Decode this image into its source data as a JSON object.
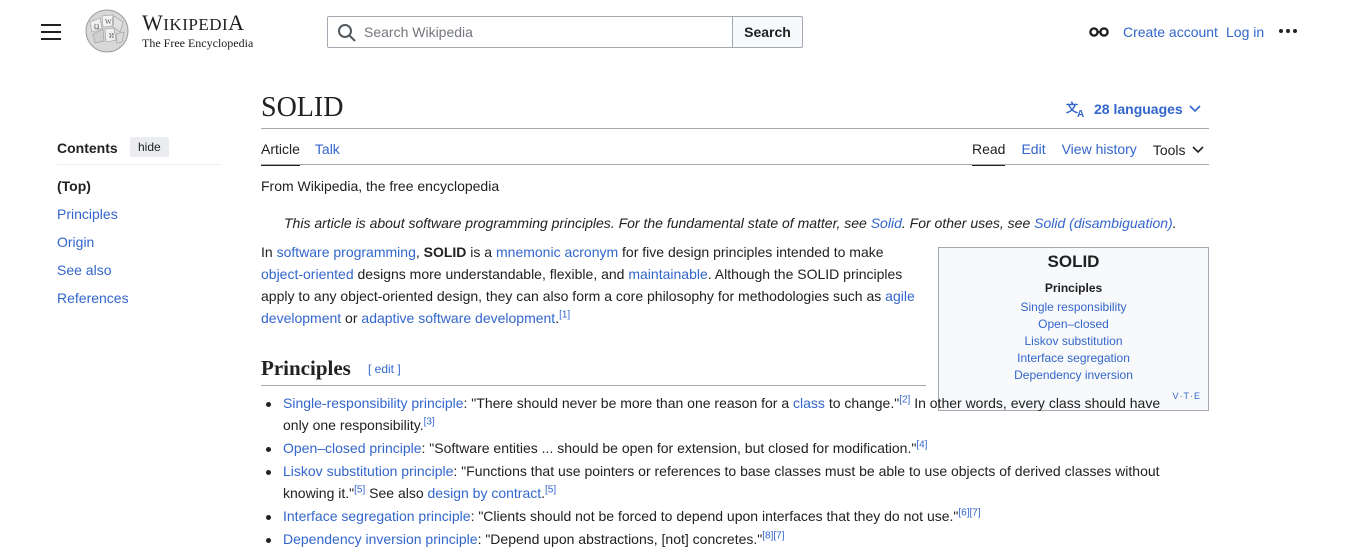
{
  "header": {
    "logo_title": "Wikipedia",
    "logo_tagline": "The Free Encyclopedia",
    "search_placeholder": "Search Wikipedia",
    "search_button": "Search",
    "create_account": "Create account",
    "log_in": "Log in",
    "icons": [
      "menu-icon",
      "wikipedia-globe-icon",
      "search-icon",
      "glasses-icon",
      "more-icon"
    ]
  },
  "toc": {
    "title": "Contents",
    "hide_label": "hide",
    "items": [
      "(Top)",
      "Principles",
      "Origin",
      "See also",
      "References"
    ]
  },
  "page": {
    "title": "SOLID",
    "languages": "28 languages",
    "tabs_left": [
      "Article",
      "Talk"
    ],
    "tabs_right": [
      "Read",
      "Edit",
      "View history",
      "Tools"
    ],
    "tagline": "From Wikipedia, the free encyclopedia"
  },
  "hatnote": {
    "t1": "This article is about software programming principles. For the fundamental state of matter, see ",
    "l1": "Solid",
    "t2": ". For other uses, see ",
    "l2": "Solid (disambiguation)",
    "t3": "."
  },
  "intro": {
    "p1": "In ",
    "l1": "software programming",
    "p2": ", ",
    "b1": "SOLID",
    "p3": " is a ",
    "l2": "mnemonic acronym",
    "p4": " for five design principles intended to make ",
    "l3": "object-oriented",
    "p5": " designs more understandable, flexible, and ",
    "l4": "maintainable",
    "p6": ". Although the SOLID principles apply to any object-oriented design, they can also form a core philosophy for methodologies such as ",
    "l5": "agile development",
    "p7": " or ",
    "l6": "adaptive software development",
    "p8": ".",
    "ref": "[1]"
  },
  "navbox": {
    "title": "SOLID",
    "subtitle": "Principles",
    "items": [
      "Single responsibility",
      "Open–closed",
      "Liskov substitution",
      "Interface segregation",
      "Dependency inversion"
    ],
    "vte": "V·T·E"
  },
  "section": {
    "heading": "Principles",
    "edit": "[ edit ]"
  },
  "bullets": [
    {
      "link": "Single-responsibility principle",
      "t1": ": \"There should never be more than one reason for a ",
      "l2": "class",
      "t2": " to change.\"",
      "r1": "[2]",
      "t3": " In other words, every class should have only one responsibility.",
      "r2": "[3]"
    },
    {
      "link": "Open–closed principle",
      "t1": ": \"Software entities ... should be open for extension, but closed for modification.\"",
      "r1": "[4]"
    },
    {
      "link": "Liskov substitution principle",
      "t1": ": \"Functions that use pointers or references to base classes must be able to use objects of derived classes without knowing it.\"",
      "r1": "[5]",
      "t2": " See also ",
      "l2": "design by contract",
      "t3": ".",
      "r2": "[5]"
    },
    {
      "link": "Interface segregation principle",
      "t1": ": \"Clients should not be forced to depend upon interfaces that they do not use.\"",
      "r1": "[6][7]"
    },
    {
      "link": "Dependency inversion principle",
      "t1": ": \"Depend upon abstractions, [not] concretes.\"",
      "r1": "[8][7]"
    }
  ]
}
